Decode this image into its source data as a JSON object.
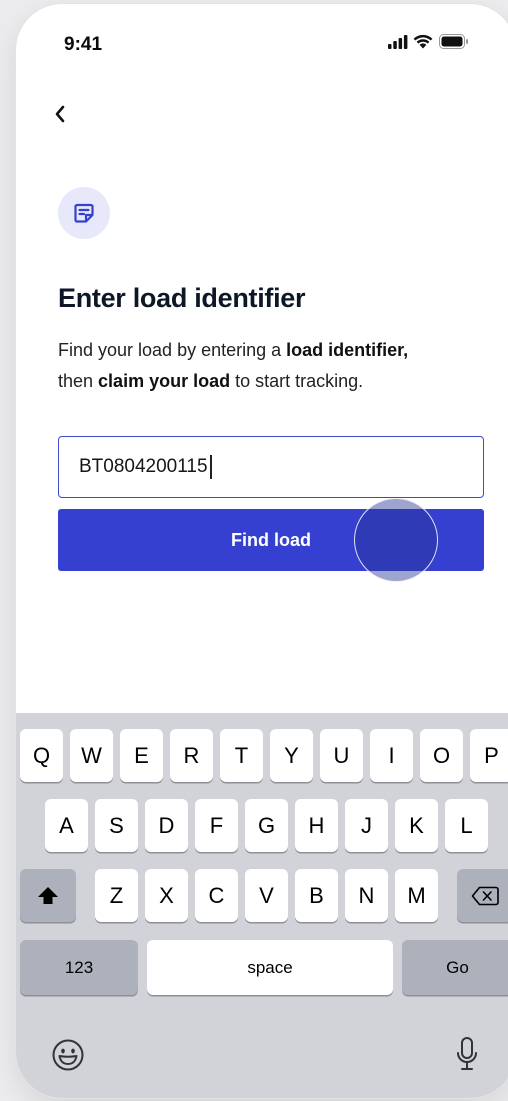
{
  "status_bar": {
    "time": "9:41",
    "icons": [
      "signal-icon",
      "wifi-icon",
      "battery-icon"
    ]
  },
  "nav": {
    "back_glyph": "‹"
  },
  "header_icon": "document-icon",
  "page": {
    "title": "Enter load identifier",
    "description": {
      "part1": "Find your load by entering a ",
      "bold1": "load identifier,",
      "part2": " then ",
      "bold2": "claim your load",
      "part3": " to start tracking."
    }
  },
  "form": {
    "load_input_value": "BT0804200115",
    "find_button_label": "Find load"
  },
  "keyboard": {
    "row1": [
      "Q",
      "W",
      "E",
      "R",
      "T",
      "Y",
      "U",
      "I",
      "O",
      "P"
    ],
    "row2": [
      "A",
      "S",
      "D",
      "F",
      "G",
      "H",
      "J",
      "K",
      "L"
    ],
    "row3": [
      "Z",
      "X",
      "C",
      "V",
      "B",
      "N",
      "M"
    ],
    "numbers_label": "123",
    "space_label": "space",
    "go_label": "Go",
    "icons": [
      "shift-icon",
      "backspace-icon",
      "emoji-icon",
      "microphone-icon"
    ]
  },
  "colors": {
    "accent": "#3540d1",
    "input_border": "#3e4cc9",
    "icon_bg": "#e7e9fb",
    "keyboard_bg": "#d1d3d9"
  }
}
